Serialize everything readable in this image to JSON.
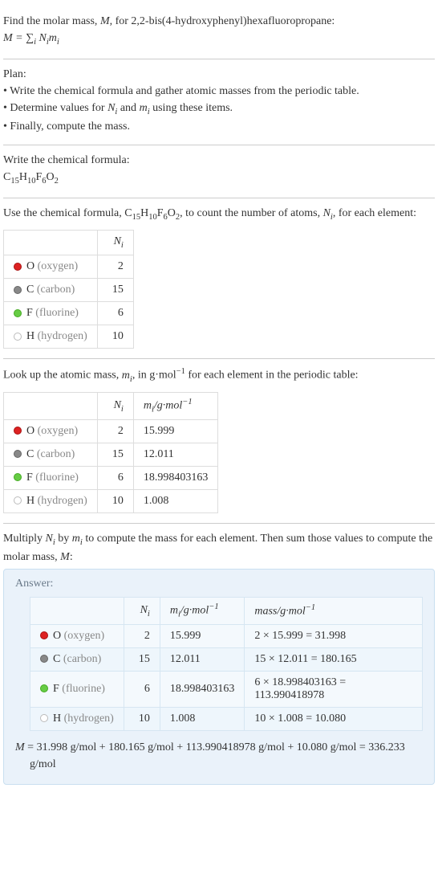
{
  "intro": {
    "line1_a": "Find the molar mass, ",
    "line1_b": ", for 2,2-bis(4-hydroxyphenyl)hexafluoropropane:",
    "eq_html": "M = ∑<sub>i</sub> N<sub>i</sub>m<sub>i</sub>"
  },
  "plan": {
    "heading": "Plan:",
    "b1": "• Write the chemical formula and gather atomic masses from the periodic table.",
    "b2_a": "• Determine values for ",
    "b2_b": " and ",
    "b2_c": " using these items.",
    "b3": "• Finally, compute the mass."
  },
  "formula_section": {
    "heading": "Write the chemical formula:",
    "formula_html": "C<sub>15</sub>H<sub>10</sub>F<sub>6</sub>O<sub>2</sub>"
  },
  "count_section": {
    "text_a": "Use the chemical formula, ",
    "text_b": ", to count the number of atoms, ",
    "text_c": ", for each element:",
    "header_Ni_html": "N<sub>i</sub>",
    "rows": [
      {
        "dot": "O",
        "sym": "O",
        "name": "(oxygen)",
        "n": "2"
      },
      {
        "dot": "C",
        "sym": "C",
        "name": "(carbon)",
        "n": "15"
      },
      {
        "dot": "F",
        "sym": "F",
        "name": "(fluorine)",
        "n": "6"
      },
      {
        "dot": "H",
        "sym": "H",
        "name": "(hydrogen)",
        "n": "10"
      }
    ]
  },
  "mass_section": {
    "text_a": "Look up the atomic mass, ",
    "text_b": ", in g·mol",
    "text_c": " for each element in the periodic table:",
    "header_Ni_html": "N<sub>i</sub>",
    "header_mi_html": "m<sub>i</sub>/g·mol<sup>−1</sup>",
    "rows": [
      {
        "dot": "O",
        "sym": "O",
        "name": "(oxygen)",
        "n": "2",
        "m": "15.999"
      },
      {
        "dot": "C",
        "sym": "C",
        "name": "(carbon)",
        "n": "15",
        "m": "12.011"
      },
      {
        "dot": "F",
        "sym": "F",
        "name": "(fluorine)",
        "n": "6",
        "m": "18.998403163"
      },
      {
        "dot": "H",
        "sym": "H",
        "name": "(hydrogen)",
        "n": "10",
        "m": "1.008"
      }
    ]
  },
  "compute_section": {
    "text_a": "Multiply ",
    "text_b": " by ",
    "text_c": " to compute the mass for each element. Then sum those values to compute the molar mass, ",
    "text_d": ":"
  },
  "answer": {
    "label": "Answer:",
    "header_Ni_html": "N<sub>i</sub>",
    "header_mi_html": "m<sub>i</sub>/g·mol<sup>−1</sup>",
    "header_mass_html": "mass/g·mol<sup>−1</sup>",
    "rows": [
      {
        "dot": "O",
        "sym": "O",
        "name": "(oxygen)",
        "n": "2",
        "m": "15.999",
        "calc": "2 × 15.999 = 31.998"
      },
      {
        "dot": "C",
        "sym": "C",
        "name": "(carbon)",
        "n": "15",
        "m": "12.011",
        "calc": "15 × 12.011 = 180.165"
      },
      {
        "dot": "F",
        "sym": "F",
        "name": "(fluorine)",
        "n": "6",
        "m": "18.998403163",
        "calc": "6 × 18.998403163 = 113.990418978"
      },
      {
        "dot": "H",
        "sym": "H",
        "name": "(hydrogen)",
        "n": "10",
        "m": "1.008",
        "calc": "10 × 1.008 = 10.080"
      }
    ],
    "final_a": "M",
    "final_b": " = 31.998 g/mol + 180.165 g/mol + 113.990418978 g/mol + 10.080 g/mol = 336.233 g/mol"
  }
}
